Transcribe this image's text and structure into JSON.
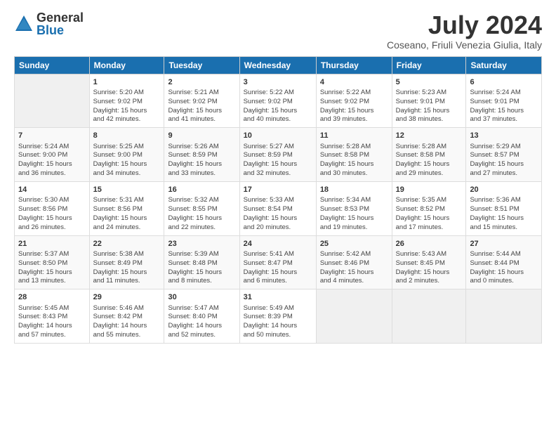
{
  "logo": {
    "general": "General",
    "blue": "Blue"
  },
  "title": "July 2024",
  "subtitle": "Coseano, Friuli Venezia Giulia, Italy",
  "days_header": [
    "Sunday",
    "Monday",
    "Tuesday",
    "Wednesday",
    "Thursday",
    "Friday",
    "Saturday"
  ],
  "weeks": [
    [
      {
        "day": "",
        "info": ""
      },
      {
        "day": "1",
        "info": "Sunrise: 5:20 AM\nSunset: 9:02 PM\nDaylight: 15 hours\nand 42 minutes."
      },
      {
        "day": "2",
        "info": "Sunrise: 5:21 AM\nSunset: 9:02 PM\nDaylight: 15 hours\nand 41 minutes."
      },
      {
        "day": "3",
        "info": "Sunrise: 5:22 AM\nSunset: 9:02 PM\nDaylight: 15 hours\nand 40 minutes."
      },
      {
        "day": "4",
        "info": "Sunrise: 5:22 AM\nSunset: 9:02 PM\nDaylight: 15 hours\nand 39 minutes."
      },
      {
        "day": "5",
        "info": "Sunrise: 5:23 AM\nSunset: 9:01 PM\nDaylight: 15 hours\nand 38 minutes."
      },
      {
        "day": "6",
        "info": "Sunrise: 5:24 AM\nSunset: 9:01 PM\nDaylight: 15 hours\nand 37 minutes."
      }
    ],
    [
      {
        "day": "7",
        "info": "Sunrise: 5:24 AM\nSunset: 9:00 PM\nDaylight: 15 hours\nand 36 minutes."
      },
      {
        "day": "8",
        "info": "Sunrise: 5:25 AM\nSunset: 9:00 PM\nDaylight: 15 hours\nand 34 minutes."
      },
      {
        "day": "9",
        "info": "Sunrise: 5:26 AM\nSunset: 8:59 PM\nDaylight: 15 hours\nand 33 minutes."
      },
      {
        "day": "10",
        "info": "Sunrise: 5:27 AM\nSunset: 8:59 PM\nDaylight: 15 hours\nand 32 minutes."
      },
      {
        "day": "11",
        "info": "Sunrise: 5:28 AM\nSunset: 8:58 PM\nDaylight: 15 hours\nand 30 minutes."
      },
      {
        "day": "12",
        "info": "Sunrise: 5:28 AM\nSunset: 8:58 PM\nDaylight: 15 hours\nand 29 minutes."
      },
      {
        "day": "13",
        "info": "Sunrise: 5:29 AM\nSunset: 8:57 PM\nDaylight: 15 hours\nand 27 minutes."
      }
    ],
    [
      {
        "day": "14",
        "info": "Sunrise: 5:30 AM\nSunset: 8:56 PM\nDaylight: 15 hours\nand 26 minutes."
      },
      {
        "day": "15",
        "info": "Sunrise: 5:31 AM\nSunset: 8:56 PM\nDaylight: 15 hours\nand 24 minutes."
      },
      {
        "day": "16",
        "info": "Sunrise: 5:32 AM\nSunset: 8:55 PM\nDaylight: 15 hours\nand 22 minutes."
      },
      {
        "day": "17",
        "info": "Sunrise: 5:33 AM\nSunset: 8:54 PM\nDaylight: 15 hours\nand 20 minutes."
      },
      {
        "day": "18",
        "info": "Sunrise: 5:34 AM\nSunset: 8:53 PM\nDaylight: 15 hours\nand 19 minutes."
      },
      {
        "day": "19",
        "info": "Sunrise: 5:35 AM\nSunset: 8:52 PM\nDaylight: 15 hours\nand 17 minutes."
      },
      {
        "day": "20",
        "info": "Sunrise: 5:36 AM\nSunset: 8:51 PM\nDaylight: 15 hours\nand 15 minutes."
      }
    ],
    [
      {
        "day": "21",
        "info": "Sunrise: 5:37 AM\nSunset: 8:50 PM\nDaylight: 15 hours\nand 13 minutes."
      },
      {
        "day": "22",
        "info": "Sunrise: 5:38 AM\nSunset: 8:49 PM\nDaylight: 15 hours\nand 11 minutes."
      },
      {
        "day": "23",
        "info": "Sunrise: 5:39 AM\nSunset: 8:48 PM\nDaylight: 15 hours\nand 8 minutes."
      },
      {
        "day": "24",
        "info": "Sunrise: 5:41 AM\nSunset: 8:47 PM\nDaylight: 15 hours\nand 6 minutes."
      },
      {
        "day": "25",
        "info": "Sunrise: 5:42 AM\nSunset: 8:46 PM\nDaylight: 15 hours\nand 4 minutes."
      },
      {
        "day": "26",
        "info": "Sunrise: 5:43 AM\nSunset: 8:45 PM\nDaylight: 15 hours\nand 2 minutes."
      },
      {
        "day": "27",
        "info": "Sunrise: 5:44 AM\nSunset: 8:44 PM\nDaylight: 15 hours\nand 0 minutes."
      }
    ],
    [
      {
        "day": "28",
        "info": "Sunrise: 5:45 AM\nSunset: 8:43 PM\nDaylight: 14 hours\nand 57 minutes."
      },
      {
        "day": "29",
        "info": "Sunrise: 5:46 AM\nSunset: 8:42 PM\nDaylight: 14 hours\nand 55 minutes."
      },
      {
        "day": "30",
        "info": "Sunrise: 5:47 AM\nSunset: 8:40 PM\nDaylight: 14 hours\nand 52 minutes."
      },
      {
        "day": "31",
        "info": "Sunrise: 5:49 AM\nSunset: 8:39 PM\nDaylight: 14 hours\nand 50 minutes."
      },
      {
        "day": "",
        "info": ""
      },
      {
        "day": "",
        "info": ""
      },
      {
        "day": "",
        "info": ""
      }
    ]
  ]
}
